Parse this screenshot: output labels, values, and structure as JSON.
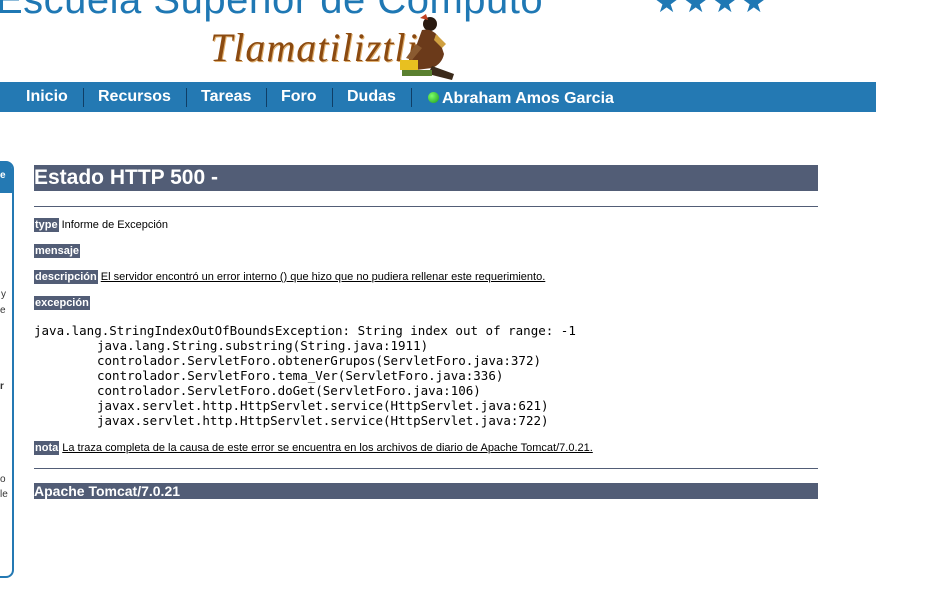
{
  "header": {
    "site_title": "Escuela Superior de Computo",
    "stars": "★★★★",
    "logo_text": "Tlamatiliztli"
  },
  "nav": {
    "items": [
      "Inicio",
      "Recursos",
      "Tareas",
      "Foro",
      "Dudas"
    ],
    "user_name": "Abraham Amos Garcia"
  },
  "side_panel": {
    "fragments": [
      "e",
      "y",
      "e",
      "r",
      "o",
      "le"
    ]
  },
  "error": {
    "title": "Estado HTTP 500 -",
    "type_label": "type",
    "type_value": "Informe de Excepción",
    "message_label": "mensaje",
    "description_label": "descripción",
    "description_value": "El servidor encontró un error interno () que hizo que no pudiera rellenar este requerimiento.",
    "exception_label": "excepción",
    "trace": [
      "java.lang.StringIndexOutOfBoundsException: String index out of range: -1",
      "java.lang.String.substring(String.java:1911)",
      "controlador.ServletForo.obtenerGrupos(ServletForo.java:372)",
      "controlador.ServletForo.tema_Ver(ServletForo.java:336)",
      "controlador.ServletForo.doGet(ServletForo.java:106)",
      "javax.servlet.http.HttpServlet.service(HttpServlet.java:621)",
      "javax.servlet.http.HttpServlet.service(HttpServlet.java:722)"
    ],
    "note_label": "nota",
    "note_value": "La traza completa de la causa de este error se encuentra en los archivos de diario de Apache Tomcat/7.0.21.",
    "footer": "Apache Tomcat/7.0.21"
  }
}
